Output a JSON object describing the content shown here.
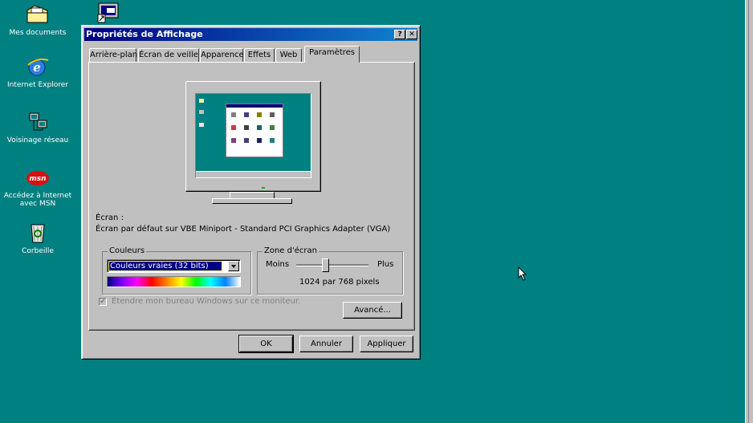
{
  "desktop": {
    "icons": [
      {
        "label": "Mes documents",
        "icon": "folder-documents-icon"
      },
      {
        "label": "Internet Explorer",
        "icon": "internet-explorer-icon"
      },
      {
        "label": "Voisinage réseau",
        "icon": "network-icon"
      },
      {
        "label": "Accédez à Internet\navec MSN",
        "icon": "msn-icon",
        "badge": "msn"
      },
      {
        "label": "Corbeille",
        "icon": "recycle-bin-icon"
      }
    ],
    "top_icon": "display-shortcut-icon"
  },
  "window": {
    "title": "Propriétés de Affichage",
    "help_button": "?",
    "close_button": "✕",
    "tabs": [
      "Arrière-plan",
      "Écran de veille",
      "Apparence",
      "Effets",
      "Web",
      "Paramètres"
    ],
    "active_tab": "Paramètres",
    "screen_label": "Écran :",
    "screen_value": "Écran par défaut sur VBE Miniport - Standard PCI Graphics Adapter (VGA)",
    "colors": {
      "legend": "Couleurs",
      "selected": "Couleurs vraies (32 bits)"
    },
    "screen_area": {
      "legend": "Zone d'écran",
      "min_label": "Moins",
      "max_label": "Plus",
      "resolution": "1024 par 768 pixels"
    },
    "extend_checkbox": {
      "label": "Étendre mon bureau Windows sur ce moniteur.",
      "checked": true,
      "disabled": true
    },
    "advanced_button": "Avancé...",
    "buttons": {
      "ok": "OK",
      "cancel": "Annuler",
      "apply": "Appliquer"
    }
  },
  "colors": {
    "desktop": "#008080",
    "title_start": "#000080",
    "title_end": "#1084d0",
    "face": "#c0c0c0"
  }
}
